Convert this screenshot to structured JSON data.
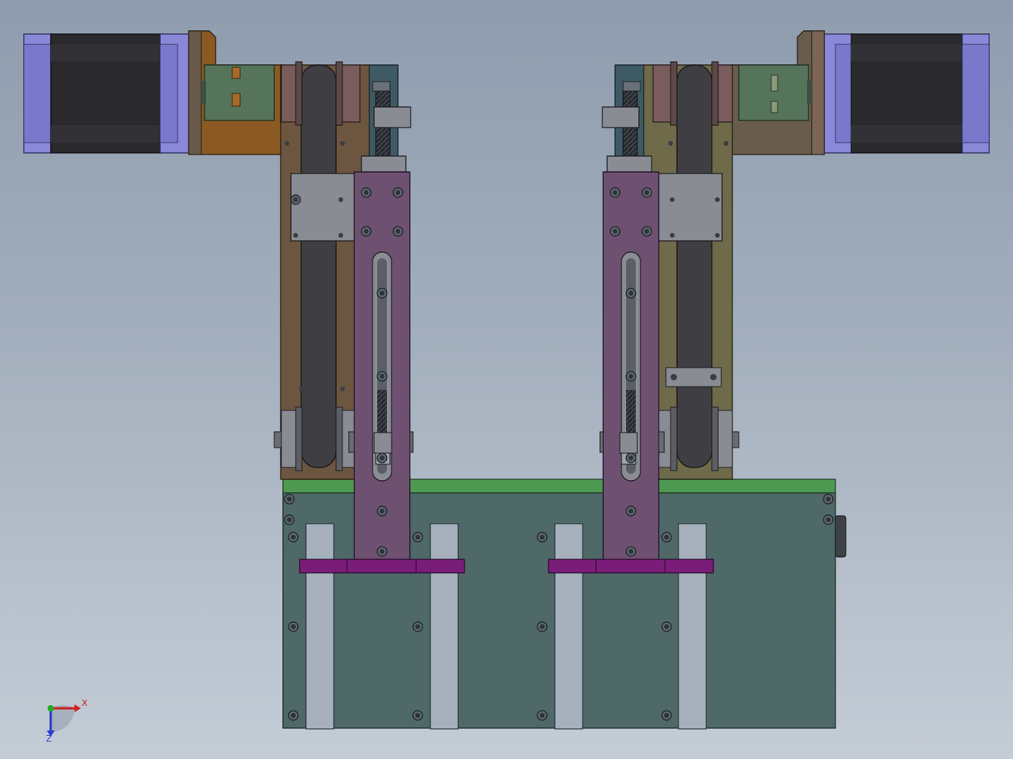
{
  "view": {
    "background_top": "#8e9cae",
    "background_bottom": "#c4ccd6"
  },
  "colors": {
    "motor_flange": "#8a88d8",
    "motor_body": "#2a2a2c",
    "coupler": "#56745a",
    "left_bracket": "#8a5a22",
    "left_plate": "#6d5640",
    "right_plate": "#6f6a4a",
    "right_bracket": "#6a5c4c",
    "belt": "#3f3f43",
    "carriage": "#6e5070",
    "slide_block": "#8a8c94",
    "lead_screw_guide": "#3e5a64",
    "base_top_rail": "#4e9a52",
    "base_plate": "#4f6868",
    "gripper_bar": "#7a1d7a"
  },
  "triad": {
    "x_label": "X",
    "z_label": "Z",
    "x_color": "#cc2222",
    "y_color": "#22aa22",
    "z_color": "#2a3fcc"
  }
}
